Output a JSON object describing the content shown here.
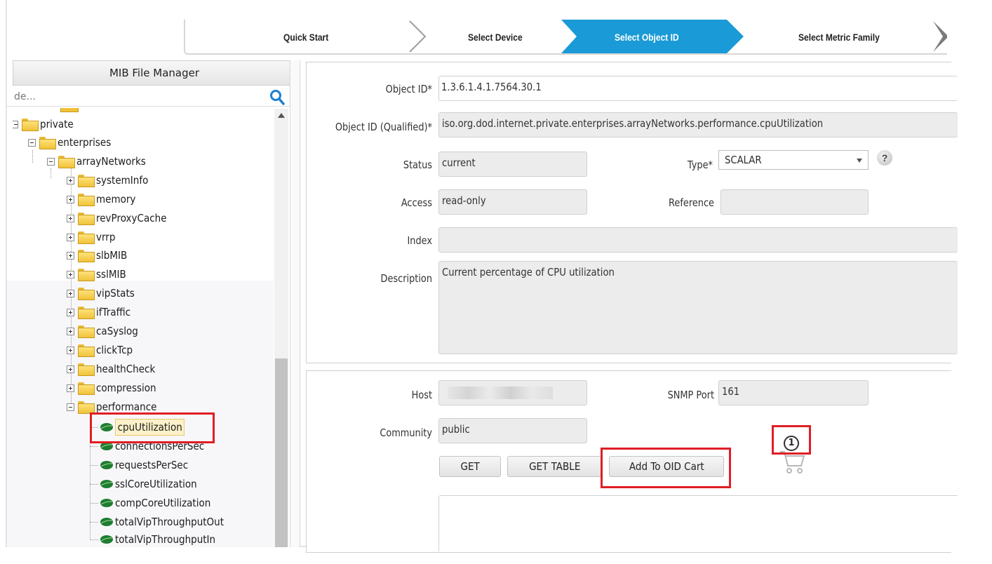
{
  "wizard": {
    "steps": [
      {
        "label": "Quick Start"
      },
      {
        "label": "Select Device"
      },
      {
        "label": "Select Object ID"
      },
      {
        "label": "Select Metric Family"
      }
    ],
    "active_color": "#1a9ad6"
  },
  "mib_manager": {
    "title": "MIB File Manager",
    "search_value": "de...",
    "tree": [
      {
        "label": "private",
        "type": "folder",
        "toggle": "minus"
      },
      {
        "label": "enterprises",
        "type": "folder",
        "toggle": "minus"
      },
      {
        "label": "arrayNetworks",
        "type": "folder",
        "toggle": "minus"
      },
      {
        "label": "systemInfo",
        "type": "folder",
        "toggle": "plus"
      },
      {
        "label": "memory",
        "type": "folder",
        "toggle": "plus"
      },
      {
        "label": "revProxyCache",
        "type": "folder",
        "toggle": "plus"
      },
      {
        "label": "vrrp",
        "type": "folder",
        "toggle": "plus"
      },
      {
        "label": "slbMIB",
        "type": "folder",
        "toggle": "plus"
      },
      {
        "label": "sslMIB",
        "type": "folder",
        "toggle": "plus"
      },
      {
        "label": "vipStats",
        "type": "folder",
        "toggle": "plus"
      },
      {
        "label": "ifTraffic",
        "type": "folder",
        "toggle": "plus"
      },
      {
        "label": "caSyslog",
        "type": "folder",
        "toggle": "plus"
      },
      {
        "label": "clickTcp",
        "type": "folder",
        "toggle": "plus"
      },
      {
        "label": "healthCheck",
        "type": "folder",
        "toggle": "plus"
      },
      {
        "label": "compression",
        "type": "folder",
        "toggle": "plus"
      },
      {
        "label": "performance",
        "type": "folder",
        "toggle": "minus"
      },
      {
        "label": "cpuUtilization",
        "type": "leaf",
        "selected": true
      },
      {
        "label": "connectionsPerSec",
        "type": "leaf"
      },
      {
        "label": "requestsPerSec",
        "type": "leaf"
      },
      {
        "label": "sslCoreUtilization",
        "type": "leaf"
      },
      {
        "label": "compCoreUtilization",
        "type": "leaf"
      },
      {
        "label": "totalVipThroughputOut",
        "type": "leaf"
      },
      {
        "label": "totalVipThroughputIn",
        "type": "leaf"
      }
    ]
  },
  "form": {
    "object_id_label": "Object ID*",
    "object_id_value": "1.3.6.1.4.1.7564.30.1",
    "object_id_qualified_label": "Object ID (Qualified)*",
    "object_id_qualified_value": "iso.org.dod.internet.private.enterprises.arrayNetworks.performance.cpuUtilization",
    "status_label": "Status",
    "status_value": "current",
    "type_label": "Type*",
    "type_value": "SCALAR",
    "help_glyph": "?",
    "access_label": "Access",
    "access_value": "read-only",
    "reference_label": "Reference",
    "reference_value": "",
    "index_label": "Index",
    "index_value": "",
    "description_label": "Description",
    "description_value": "Current percentage of CPU utilization"
  },
  "snmp": {
    "host_label": "Host",
    "host_value": "",
    "port_label": "SNMP Port",
    "port_value": "161",
    "community_label": "Community",
    "community_value": "public",
    "get_button": "GET",
    "get_table_button": "GET TABLE",
    "add_cart_button": "Add To OID Cart",
    "cart_count": "1"
  },
  "colors": {
    "highlight_red": "#e01e25",
    "active_step": "#1a9ad6"
  }
}
